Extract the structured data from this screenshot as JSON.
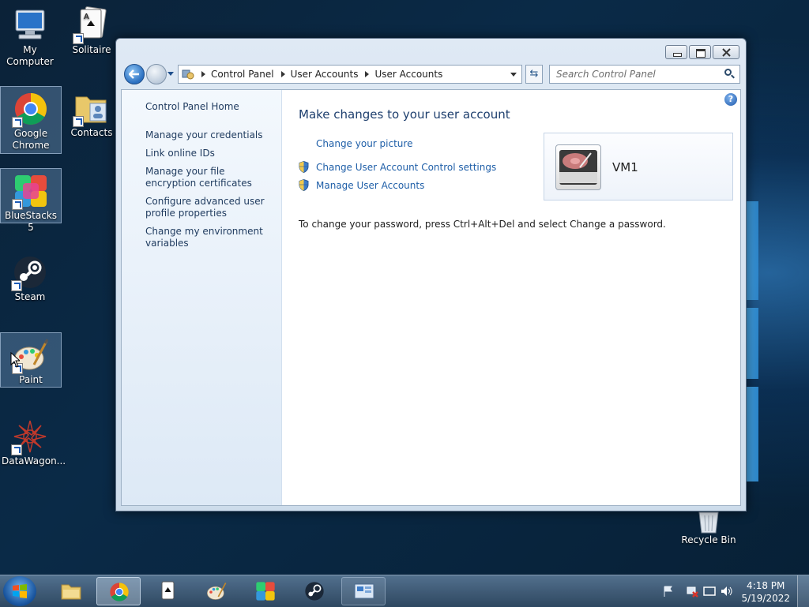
{
  "desktop": {
    "icons": [
      {
        "label": "My Computer"
      },
      {
        "label": "Solitaire"
      },
      {
        "label": "Google Chrome"
      },
      {
        "label": "Contacts"
      },
      {
        "label": "BlueStacks 5"
      },
      {
        "label": "Steam"
      },
      {
        "label": "Paint"
      },
      {
        "label": "DataWagon..."
      },
      {
        "label": "Recycle Bin"
      }
    ]
  },
  "window": {
    "address": {
      "crumbs": [
        "Control Panel",
        "User Accounts",
        "User Accounts"
      ]
    },
    "search": {
      "placeholder": "Search Control Panel"
    },
    "left_pane": {
      "home": "Control Panel Home",
      "links": [
        "Manage your credentials",
        "Link online IDs",
        "Manage your file encryption certificates",
        "Configure advanced user profile properties",
        "Change my environment variables"
      ]
    },
    "main": {
      "title": "Make changes to your user account",
      "tasks": [
        "Change your picture",
        "Change User Account Control settings",
        "Manage User Accounts"
      ],
      "info": "To change your password, press Ctrl+Alt+Del and select Change a password.",
      "user_name": "VM1"
    },
    "help_glyph": "?"
  },
  "taskbar": {
    "clock_time": "4:18 PM",
    "clock_date": "5/19/2022"
  }
}
